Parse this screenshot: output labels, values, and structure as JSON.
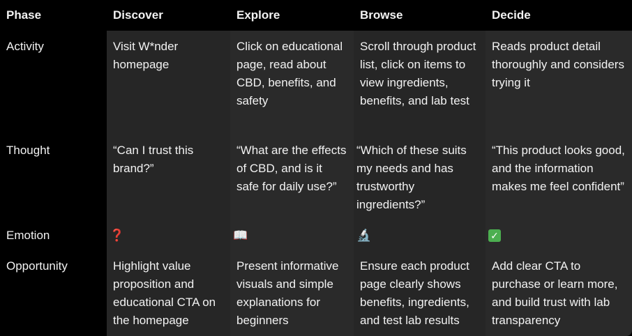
{
  "table": {
    "header": {
      "phase": "Phase",
      "discover": "Discover",
      "explore": "Explore",
      "browse": "Browse",
      "decide": "Decide"
    },
    "rows": {
      "activity": {
        "label": "Activity",
        "discover": "Visit W*nder homepage",
        "explore": "Click on educational page, read about CBD, benefits, and safety",
        "browse": "Scroll through product list, click on items to view ingredients, benefits, and lab test",
        "decide": "Reads product detail thoroughly and considers trying it"
      },
      "thought": {
        "label": "Thought",
        "discover": "“Can I trust this brand?”",
        "explore": "“What are the effects of CBD, and is it safe for daily use?”",
        "browse": "“Which of these suits my needs and has trustworthy ingredients?”",
        "decide": "“This product looks good, and the information makes me feel confident”"
      },
      "emotion": {
        "label": "Emotion",
        "discover": "❓",
        "explore": "📖",
        "browse": "🔬",
        "decide": "✓",
        "icons": {
          "discover": "question-mark-icon",
          "explore": "open-book-icon",
          "browse": "microscope-icon",
          "decide": "check-mark-icon"
        }
      },
      "opportunity": {
        "label": "Opportunity",
        "discover": "Highlight value proposition and educational CTA on the homepage",
        "explore": "Present informative visuals and simple explanations for beginners",
        "browse": "Ensure each product page clearly shows benefits, ingredients, and test lab results",
        "decide": "Add clear CTA to purchase or learn more, and build trust with lab transparency"
      }
    }
  },
  "colors": {
    "background": "#000000",
    "cell": "#262626",
    "text": "#f2f2f2",
    "check": "#4caf50",
    "question": "#e53935"
  }
}
